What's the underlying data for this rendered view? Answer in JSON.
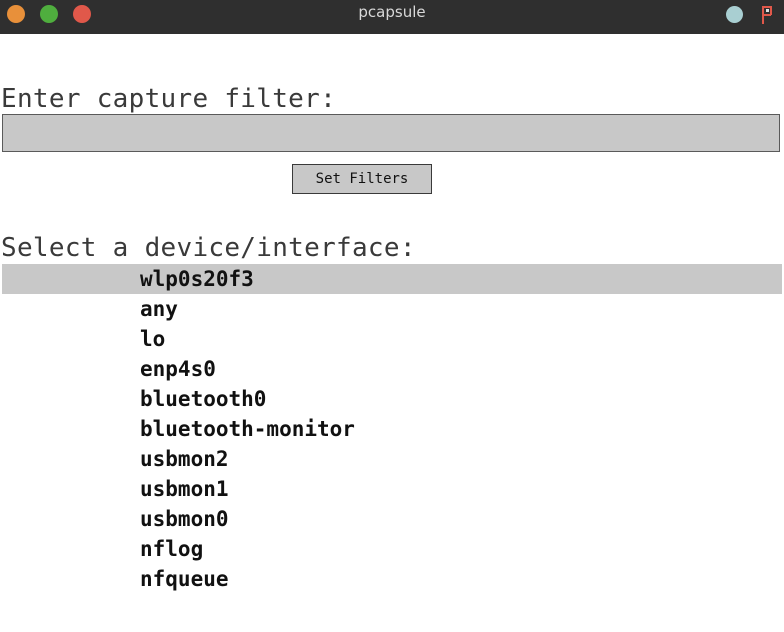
{
  "window": {
    "title": "pcapsule",
    "traffic_lights": {
      "minimize_color": "#e8903a",
      "maximize_color": "#4fae3e",
      "close_color": "#e0584a"
    },
    "tray": {
      "circle_color": "#a9cfd2",
      "logo_icon": "pcapsule-logo-icon"
    }
  },
  "filter": {
    "label": "Enter capture filter:",
    "value": "",
    "placeholder": "",
    "button_label": "Set Filters"
  },
  "devices": {
    "label": "Select a device/interface:",
    "selected_index": 0,
    "items": [
      "wlp0s20f3",
      "any",
      "lo",
      "enp4s0",
      "bluetooth0",
      "bluetooth-monitor",
      "usbmon2",
      "usbmon1",
      "usbmon0",
      "nflog",
      "nfqueue"
    ]
  },
  "colors": {
    "titlebar": "#2f2f2f",
    "field_background": "#c8c8c8",
    "selection": "#c8c8c8"
  }
}
